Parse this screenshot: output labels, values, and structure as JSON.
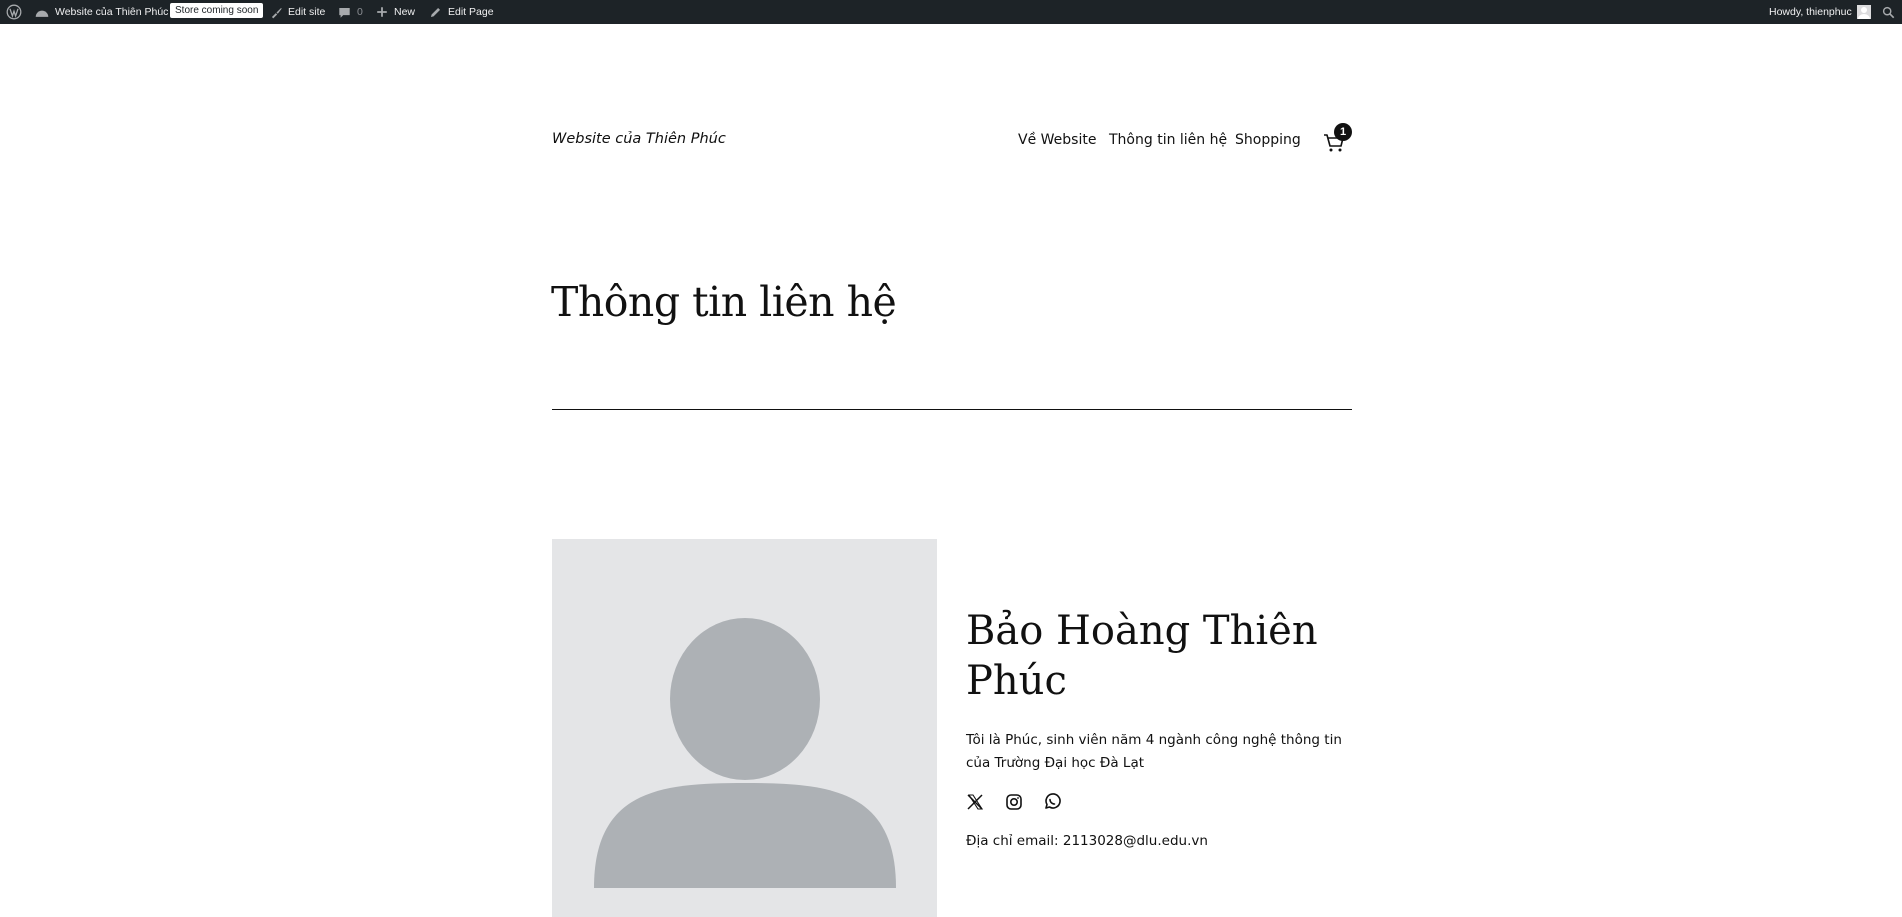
{
  "admin_bar": {
    "site_name": "Website của Thiên Phúc",
    "store_badge": "Store coming soon",
    "edit_site": "Edit site",
    "comments_count": "0",
    "new_label": "New",
    "edit_page": "Edit Page",
    "howdy": "Howdy, thienphuc"
  },
  "header": {
    "site_title": "Website của Thiên Phúc",
    "nav": [
      "Về Website",
      "Thông tin liên hệ",
      "Shopping"
    ],
    "cart_count": "1"
  },
  "main": {
    "page_title": "Thông tin liên hệ",
    "name": "Bảo Hoàng Thiên Phúc",
    "bio": "Tôi là Phúc, sinh viên năm 4 ngành công nghệ thông tin của Trường Đại học Đà Lạt",
    "email": "Địa chỉ email: 2113028@dlu.edu.vn"
  },
  "icons": [
    "wordpress-icon",
    "dashboard-icon",
    "brush-icon",
    "comment-icon",
    "plus-icon",
    "pencil-icon",
    "user-avatar-icon",
    "search-icon",
    "cart-icon",
    "x-icon",
    "instagram-icon",
    "whatsapp-icon"
  ]
}
